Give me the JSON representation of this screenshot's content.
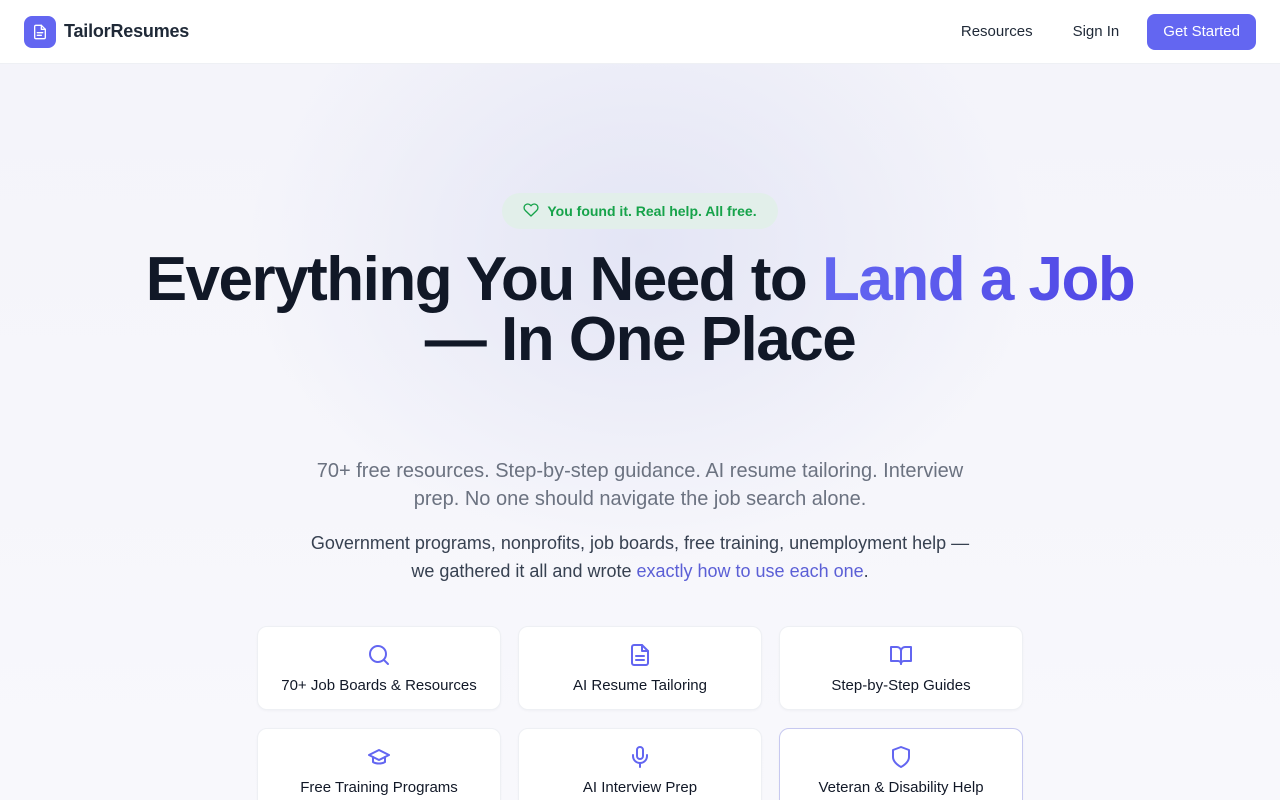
{
  "header": {
    "brand": "TailorResumes",
    "nav": {
      "resources": "Resources",
      "sign_in": "Sign In",
      "get_started": "Get Started"
    }
  },
  "hero": {
    "badge": "You found it. Real help. All free.",
    "headline": {
      "part1": "Everything You Need to ",
      "accent": "Land a Job",
      "part2": "— In One Place"
    },
    "subheading": "70+ free resources. Step-by-step guidance. AI resume tailoring. Interview prep. No one should navigate the job search alone.",
    "description": {
      "text": "Government programs, nonprofits, job boards, free training, unemployment help — we gathered it all and wrote ",
      "link": "exactly how to use each one",
      "end": "."
    }
  },
  "features": [
    {
      "label": "70+ Job Boards & Resources",
      "icon": "search-icon"
    },
    {
      "label": "AI Resume Tailoring",
      "icon": "document-icon"
    },
    {
      "label": "Step-by-Step Guides",
      "icon": "book-icon"
    },
    {
      "label": "Free Training Programs",
      "icon": "graduation-cap-icon"
    },
    {
      "label": "AI Interview Prep",
      "icon": "microphone-icon"
    },
    {
      "label": "Veteran & Disability Help",
      "icon": "shield-icon"
    }
  ],
  "colors": {
    "accent": "#6366f1",
    "badge_text": "#16a34a",
    "badge_bg": "#e2efea",
    "link": "#5b5fd6"
  }
}
